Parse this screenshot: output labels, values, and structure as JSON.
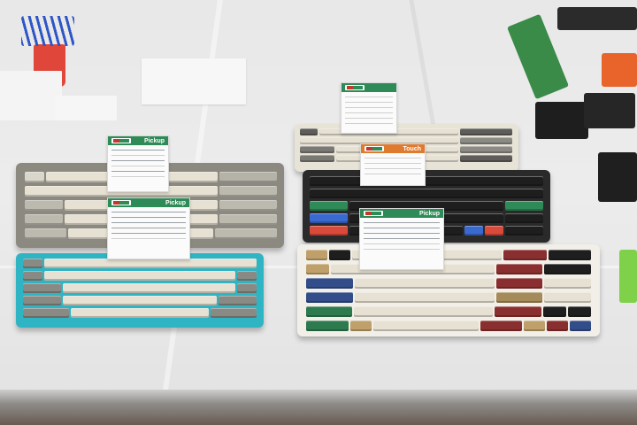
{
  "scene": {
    "cards": [
      {
        "id": "card-pickup-left",
        "label": "Pickup",
        "color": "#2e8b57"
      },
      {
        "id": "card-pickup-mid",
        "label": "Pickup",
        "color": "#2e8b57"
      },
      {
        "id": "card-pickup-right",
        "label": "Pickup",
        "color": "#2e8b57"
      },
      {
        "id": "card-touch",
        "label": "Touch",
        "color": "#e07a2e"
      },
      {
        "id": "card-back",
        "label": "",
        "color": "#2e8b57"
      }
    ],
    "colors": {
      "cloth": "#e8e8e8",
      "keycap_beige": "#e6e1d3",
      "keycap_grey": "#9a9890",
      "keycap_black": "#1e1e1e",
      "teal_case": "#2fb4c4",
      "accent_red": "#8a2f2f",
      "accent_blue": "#334d8a",
      "accent_green": "#2e7a4f"
    }
  }
}
